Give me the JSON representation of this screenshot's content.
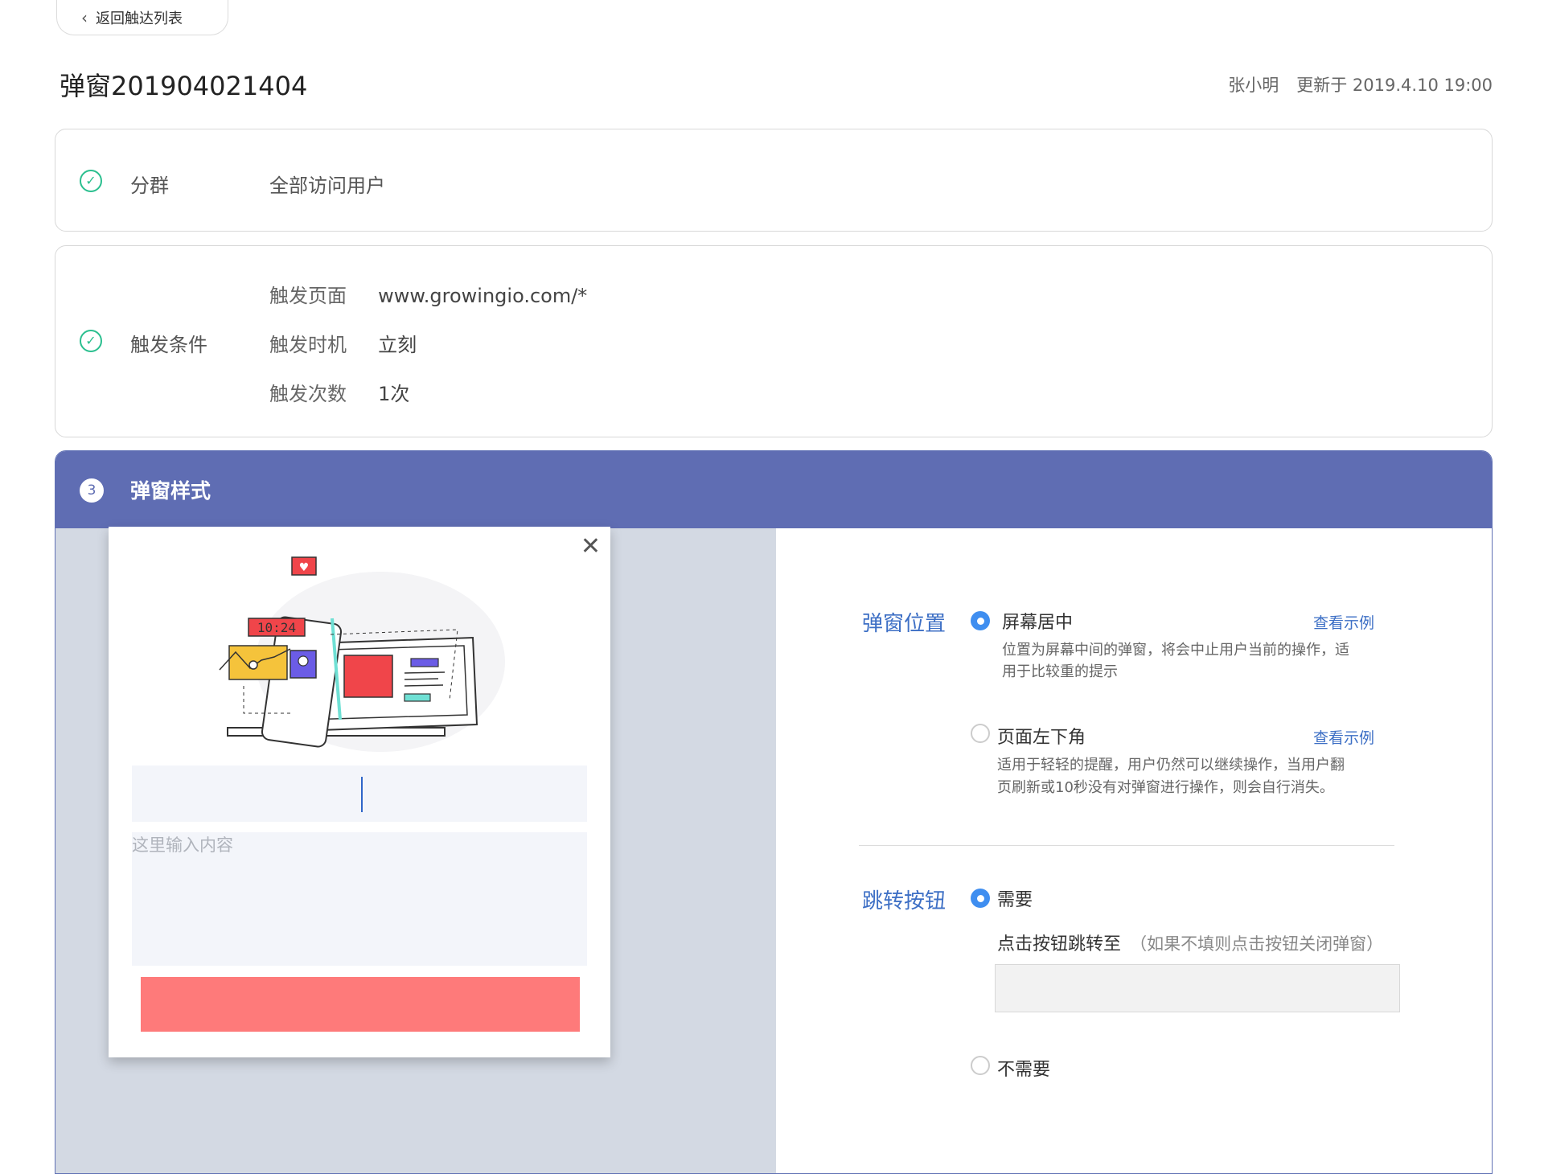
{
  "back_button": {
    "label": "返回触达列表"
  },
  "header": {
    "title": "弹窗201904021404",
    "author": "张小明",
    "updated": "更新于 2019.4.10 19:00"
  },
  "segment_section": {
    "label": "分群",
    "value": "全部访问用户"
  },
  "trigger_section": {
    "label": "触发条件",
    "rows": [
      {
        "key": "触发页面",
        "value": "www.growingio.com/*"
      },
      {
        "key": "触发时机",
        "value": "立刻"
      },
      {
        "key": "触发次数",
        "value": "1次"
      }
    ]
  },
  "style_section": {
    "step": "3",
    "title": "弹窗样式",
    "preview": {
      "time_label": "10:24",
      "textarea_placeholder": "这里输入内容"
    },
    "position": {
      "label": "弹窗位置",
      "options": [
        {
          "label": "屏幕居中",
          "selected": true,
          "link": "查看示例",
          "desc1": "位置为屏幕中间的弹窗，将会中止用户当前的操作，适",
          "desc2": "用于比较重的提示"
        },
        {
          "label": "页面左下角",
          "selected": false,
          "link": "查看示例",
          "desc1": "适用于轻轻的提醒，用户仍然可以继续操作，当用户翻",
          "desc2": "页刷新或10秒没有对弹窗进行操作，则会自行消失。"
        }
      ]
    },
    "jump_button": {
      "label": "跳转按钮",
      "need_label": "需要",
      "target_label": "点击按钮跳转至",
      "target_hint": "（如果不填则点击按钮关闭弹窗）",
      "target_value": "",
      "no_need_label": "不需要"
    }
  },
  "colors": {
    "accent_blue": "#5f6db3",
    "link_blue": "#3d6fc5",
    "check_green": "#2bbf8f",
    "popup_button": "#fe7a7a",
    "preview_bg": "#d3d9e3"
  }
}
